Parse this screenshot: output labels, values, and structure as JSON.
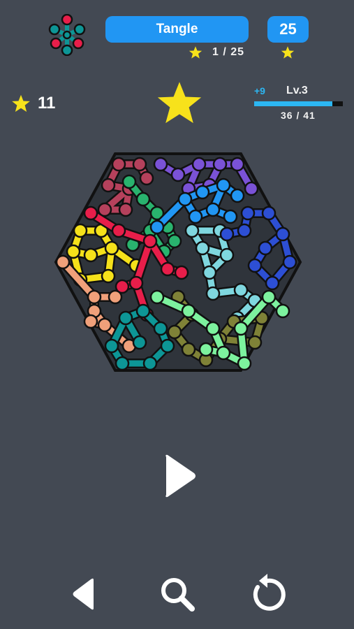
{
  "header": {
    "title": "Tangle",
    "level_number": "25",
    "stage_progress": "1 / 25"
  },
  "player": {
    "stars": "11",
    "xp_gain": "+9",
    "level": "Lv.3",
    "xp_text": "36 / 41",
    "xp_fraction": 0.878
  },
  "puzzle": {
    "shape": "hexagon",
    "line_colors": [
      "#b5415c",
      "#7a52d6",
      "#29b36e",
      "#2196f3",
      "#f5e11a",
      "#e81e4a",
      "#7fd7df",
      "#2d4fd4",
      "#f0a07a",
      "#0d9696",
      "#7f8237",
      "#7df29e"
    ]
  },
  "controls": {
    "play": "play-icon",
    "back": "back-icon",
    "search": "search-icon",
    "restart": "restart-icon"
  },
  "colors": {
    "background": "#434953",
    "accent_blue": "#2196f3",
    "star_yellow": "#f7e21b",
    "xp_blue": "#2cb6f2"
  }
}
